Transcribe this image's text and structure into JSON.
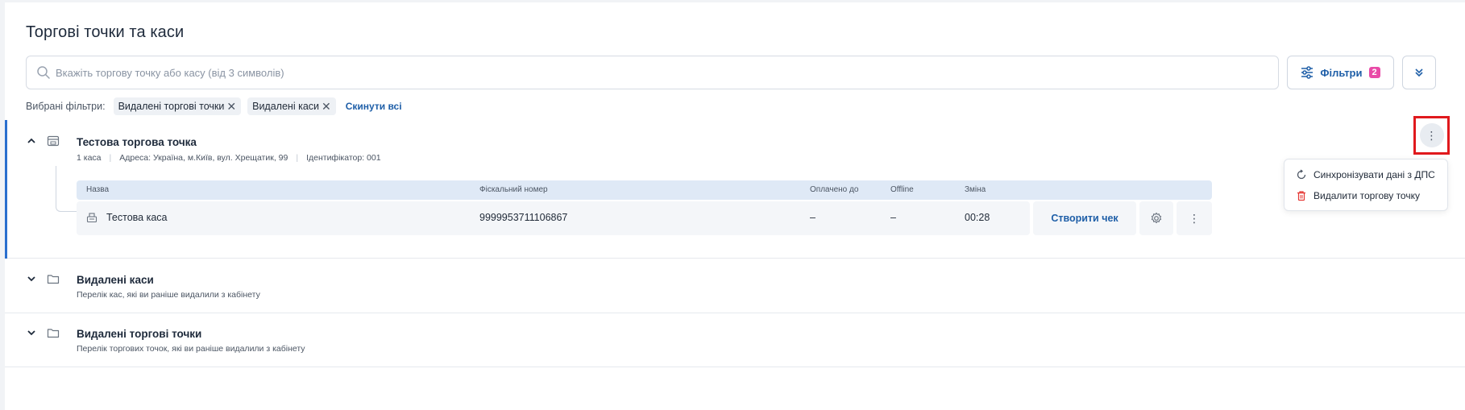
{
  "page_title": "Торгові точки та каси",
  "search": {
    "placeholder": "Вкажіть торгову точку або касу (від 3 символів)",
    "value": ""
  },
  "filter_button": {
    "label": "Фільтри",
    "count": "2"
  },
  "selected_filters": {
    "label": "Вибрані фільтри:",
    "chips": [
      "Видалені торгові точки",
      "Видалені каси"
    ],
    "reset_label": "Скинути всі"
  },
  "store": {
    "name": "Тестова торгова точка",
    "meta": [
      "1 каса",
      "Адреса: Україна, м.Київ, вул. Хрещатик, 99",
      "Ідентифікатор: 001"
    ],
    "table": {
      "headers": [
        "Назва",
        "Фіскальний номер",
        "Оплачено до",
        "Offline",
        "Зміна"
      ],
      "rows": [
        {
          "name": "Тестова каса",
          "fiscal_number": "9999953711106867",
          "paid_until": "–",
          "offline": "–",
          "shift": "00:28",
          "action_label": "Створити чек"
        }
      ]
    }
  },
  "deleted_registers": {
    "title": "Видалені каси",
    "subtitle": "Перелік кас, які ви раніше видалили з кабінету"
  },
  "deleted_stores": {
    "title": "Видалені торгові точки",
    "subtitle": "Перелік торгових точок, які ви раніше видалили з кабінету"
  },
  "context_menu": {
    "items": [
      {
        "label": "Синхронізувати дані з ДПС",
        "icon": "sync-icon"
      },
      {
        "label": "Видалити торгову точку",
        "icon": "trash-icon"
      }
    ]
  },
  "colors": {
    "accent": "#1f5fa8",
    "badge": "#e94aa7",
    "highlight_border": "#e0191d",
    "danger": "#e53935"
  }
}
